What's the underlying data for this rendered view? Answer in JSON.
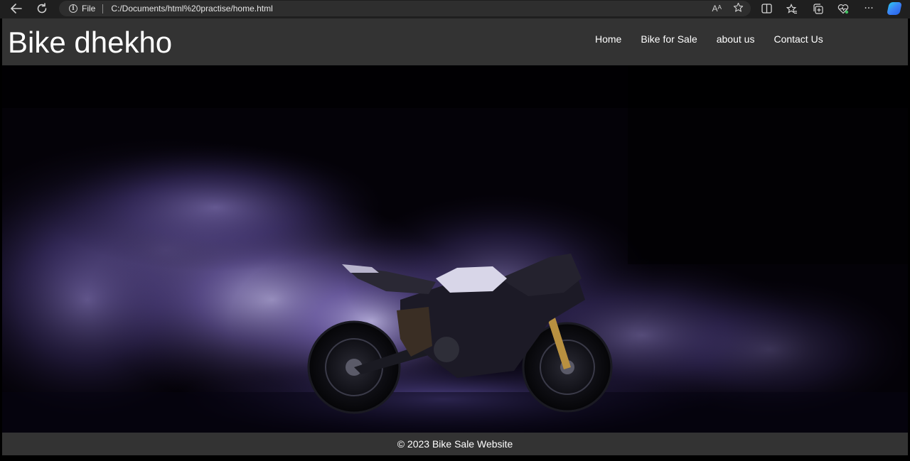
{
  "browser": {
    "back_icon": "back-arrow-icon",
    "refresh_icon": "refresh-icon",
    "info_icon": "info-icon",
    "file_label": "File",
    "url": "C:/Documents/html%20practise/home.html",
    "read_aloud_label": "Aᴬ",
    "favorite_icon": "star-icon",
    "split_screen_icon": "split-screen-icon",
    "favorites_icon": "favorites-icon",
    "collections_icon": "collections-icon",
    "health_icon": "browser-essentials-icon",
    "more_label": "···",
    "copilot_icon": "copilot-icon"
  },
  "site": {
    "title": "Bike dhekho",
    "nav": [
      {
        "label": "Home"
      },
      {
        "label": "Bike for Sale"
      },
      {
        "label": "about us"
      },
      {
        "label": "Contact Us"
      }
    ],
    "hero_image": "motorcycle-in-purple-smoke",
    "footer": "© 2023 Bike Sale Website"
  },
  "colors": {
    "header_bg": "#333333",
    "page_bg": "#000000",
    "smoke": "#8a78c8",
    "text": "#ffffff"
  }
}
